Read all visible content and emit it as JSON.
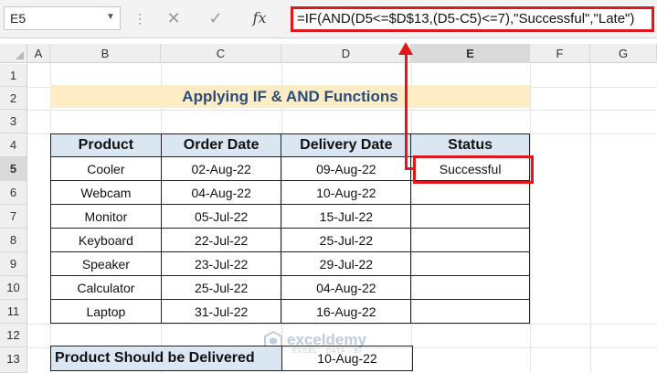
{
  "formula_bar": {
    "name_box": "E5",
    "fx_label": "fx",
    "formula": "=IF(AND(D5<=$D$13,(D5-C5)<=7),\"Successful\",\"Late\")"
  },
  "columns": [
    "A",
    "B",
    "C",
    "D",
    "E",
    "F",
    "G"
  ],
  "rows": [
    "1",
    "2",
    "3",
    "4",
    "5",
    "6",
    "7",
    "8",
    "9",
    "10",
    "11",
    "12",
    "13"
  ],
  "sheet": {
    "title": "Applying IF & AND Functions",
    "headers": [
      "Product",
      "Order Date",
      "Delivery Date",
      "Status"
    ],
    "table": [
      [
        "Cooler",
        "02-Aug-22",
        "09-Aug-22",
        "Successful"
      ],
      [
        "Webcam",
        "04-Aug-22",
        "10-Aug-22",
        ""
      ],
      [
        "Monitor",
        "05-Jul-22",
        "15-Jul-22",
        ""
      ],
      [
        "Keyboard",
        "22-Jul-22",
        "25-Jul-22",
        ""
      ],
      [
        "Speaker",
        "23-Jul-22",
        "29-Jul-22",
        ""
      ],
      [
        "Calculator",
        "25-Jul-22",
        "04-Aug-22",
        ""
      ],
      [
        "Laptop",
        "31-Jul-22",
        "16-Aug-22",
        ""
      ]
    ],
    "should_deliver_label": "Product Should be Delivered",
    "should_deliver_value": "10-Aug-22"
  },
  "watermark": {
    "name": "exceldemy",
    "tagline": "EXCEL · DATA · BI"
  },
  "colors": {
    "highlight_red": "#e0181b",
    "title_fill": "#fdecc4",
    "header_fill": "#dbe6f3",
    "title_text": "#2b4b79"
  }
}
